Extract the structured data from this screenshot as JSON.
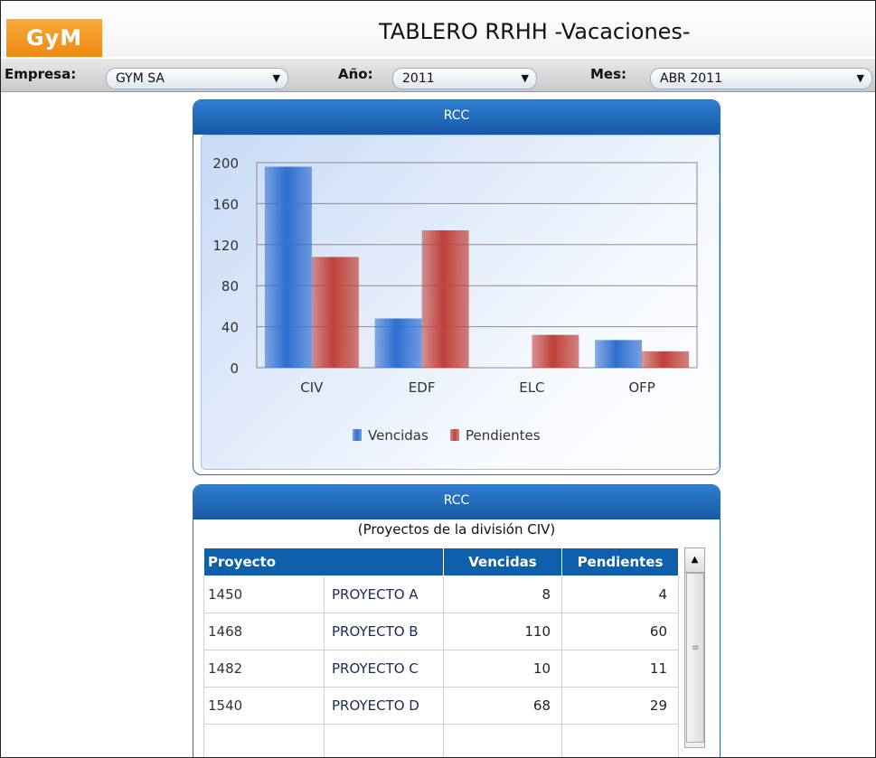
{
  "header": {
    "logo": "GyM",
    "title": "TABLERO RRHH -Vacaciones-"
  },
  "filters": {
    "empresa_label": "Empresa:",
    "empresa_value": "GYM SA",
    "anio_label": "Año:",
    "anio_value": "2011",
    "mes_label": "Mes:",
    "mes_value": "ABR 2011"
  },
  "chart_panel": {
    "title": "RCC"
  },
  "table_panel": {
    "title": "RCC",
    "subtitle": "(Proyectos de la división CIV)",
    "columns": [
      "Proyecto",
      "Vencidas",
      "Pendientes"
    ],
    "rows": [
      {
        "code": "1450",
        "name": "PROYECTO A",
        "vencidas": "8",
        "pendientes": "4"
      },
      {
        "code": "1468",
        "name": "PROYECTO B",
        "vencidas": "110",
        "pendientes": "60"
      },
      {
        "code": "1482",
        "name": "PROYECTO C",
        "vencidas": "10",
        "pendientes": "11"
      },
      {
        "code": "1540",
        "name": "PROYECTO D",
        "vencidas": "68",
        "pendientes": "29"
      }
    ]
  },
  "chart_data": {
    "type": "bar",
    "categories": [
      "CIV",
      "EDF",
      "ELC",
      "OFP"
    ],
    "series": [
      {
        "name": "Vencidas",
        "values": [
          196,
          48,
          0,
          27
        ],
        "color": "#2f6fd0"
      },
      {
        "name": "Pendientes",
        "values": [
          108,
          134,
          32,
          16
        ],
        "color": "#c0413a"
      }
    ],
    "ylim": [
      0,
      200
    ],
    "yticks": [
      "0",
      "40",
      "80",
      "120",
      "160",
      "200"
    ],
    "legend": "bottom",
    "grid": true
  }
}
